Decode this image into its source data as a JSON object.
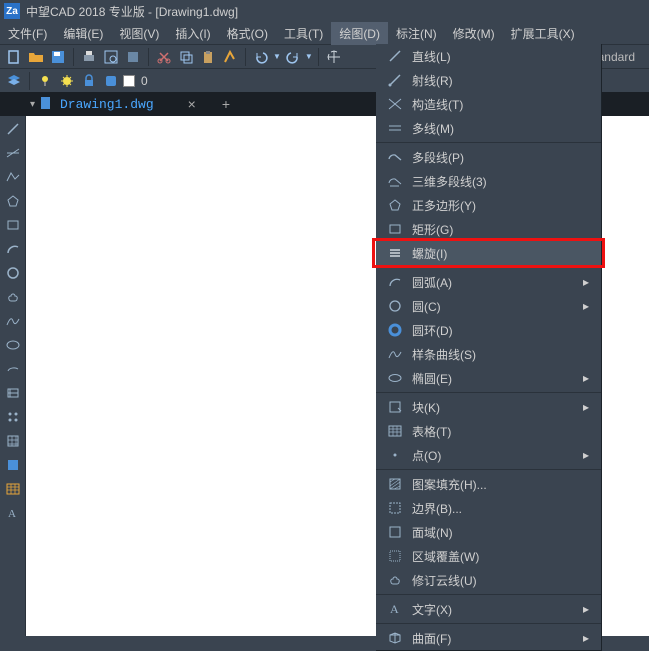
{
  "title": "中望CAD 2018 专业版 - [Drawing1.dwg]",
  "menubar": [
    "文件(F)",
    "编辑(E)",
    "视图(V)",
    "插入(I)",
    "格式(O)",
    "工具(T)",
    "绘图(D)",
    "标注(N)",
    "修改(M)",
    "扩展工具(X)"
  ],
  "active_menu_index": 6,
  "toolbar2": {
    "layer_name": "0",
    "standard": "Standard"
  },
  "document_tab": {
    "name": "Drawing1.dwg"
  },
  "draw_menu": {
    "groups": [
      [
        {
          "label": "直线(L)",
          "icon": "line",
          "sub": false
        },
        {
          "label": "射线(R)",
          "icon": "ray",
          "sub": false
        },
        {
          "label": "构造线(T)",
          "icon": "xline",
          "sub": false
        },
        {
          "label": "多线(M)",
          "icon": "mline",
          "sub": false
        }
      ],
      [
        {
          "label": "多段线(P)",
          "icon": "pline",
          "sub": false
        },
        {
          "label": "三维多段线(3)",
          "icon": "3dpline",
          "sub": false
        },
        {
          "label": "正多边形(Y)",
          "icon": "polygon",
          "sub": false
        },
        {
          "label": "矩形(G)",
          "icon": "rectangle",
          "sub": false
        },
        {
          "label": "螺旋(I)",
          "icon": "helix",
          "sub": false,
          "highlighted": true
        }
      ],
      [
        {
          "label": "圆弧(A)",
          "icon": "arc",
          "sub": true
        },
        {
          "label": "圆(C)",
          "icon": "circle",
          "sub": true
        },
        {
          "label": "圆环(D)",
          "icon": "donut",
          "sub": false
        },
        {
          "label": "样条曲线(S)",
          "icon": "spline",
          "sub": false
        },
        {
          "label": "椭圆(E)",
          "icon": "ellipse",
          "sub": true
        }
      ],
      [
        {
          "label": "块(K)",
          "icon": "block",
          "sub": true
        },
        {
          "label": "表格(T)",
          "icon": "table",
          "sub": false
        },
        {
          "label": "点(O)",
          "icon": "point",
          "sub": true
        }
      ],
      [
        {
          "label": "图案填充(H)...",
          "icon": "hatch",
          "sub": false
        },
        {
          "label": "边界(B)...",
          "icon": "boundary",
          "sub": false
        },
        {
          "label": "面域(N)",
          "icon": "region",
          "sub": false
        },
        {
          "label": "区域覆盖(W)",
          "icon": "wipeout",
          "sub": false
        },
        {
          "label": "修订云线(U)",
          "icon": "revcloud",
          "sub": false
        }
      ],
      [
        {
          "label": "文字(X)",
          "icon": "text",
          "sub": true
        }
      ],
      [
        {
          "label": "曲面(F)",
          "icon": "surface",
          "sub": true
        }
      ]
    ]
  }
}
